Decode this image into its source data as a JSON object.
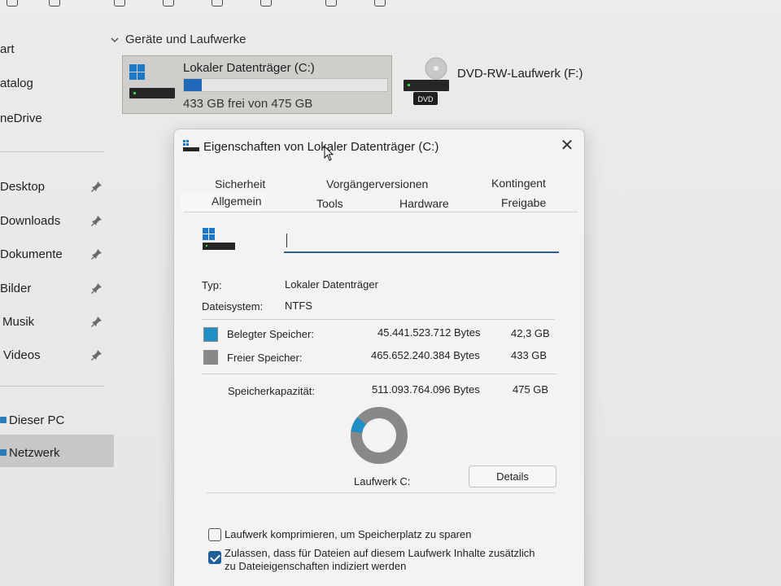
{
  "explorer": {
    "sidebar": {
      "items": [
        {
          "label": "art"
        },
        {
          "label": "atalog"
        },
        {
          "label": "neDrive"
        },
        {
          "label": "Desktop"
        },
        {
          "label": "Downloads"
        },
        {
          "label": "Dokumente"
        },
        {
          "label": "Bilder"
        },
        {
          "label": "Musik"
        },
        {
          "label": "Videos"
        },
        {
          "label": "Dieser PC"
        },
        {
          "label": "Netzwerk"
        }
      ]
    },
    "section_header": "Geräte und Laufwerke",
    "drive_c": {
      "name": "Lokaler Datenträger (C:)",
      "free_text": "433 GB frei von 475 GB",
      "used_fraction": 0.089
    },
    "drive_f": {
      "name": "DVD-RW-Laufwerk (F:)",
      "badge": "DVD"
    }
  },
  "dialog": {
    "title": "Eigenschaften von Lokaler Datenträger (C:)",
    "close_glyph": "✕",
    "tabs_row1": [
      "Sicherheit",
      "Vorgängerversionen",
      "Kontingent"
    ],
    "tabs_row2": [
      "Allgemein",
      "Tools",
      "Hardware",
      "Freigabe"
    ],
    "active_tab": "Allgemein",
    "name_value": "",
    "type_label": "Typ:",
    "type_value": "Lokaler Datenträger",
    "fs_label": "Dateisystem:",
    "fs_value": "NTFS",
    "used_label": "Belegter Speicher:",
    "used_bytes": "45.441.523.712 Bytes",
    "used_gb": "42,3 GB",
    "free_label": "Freier Speicher:",
    "free_bytes": "465.652.240.384 Bytes",
    "free_gb": "433 GB",
    "capacity_label": "Speicherkapazität:",
    "capacity_bytes": "511.093.764.096 Bytes",
    "capacity_gb": "475 GB",
    "drive_label": "Laufwerk C:",
    "details_button": "Details",
    "compress_label": "Laufwerk komprimieren, um Speicherplatz zu sparen",
    "compress_checked": false,
    "index_label_line1": "Zulassen, dass für Dateien auf diesem Laufwerk Inhalte zusätzlich",
    "index_label_line2": "zu Dateieigenschaften indiziert werden",
    "index_checked": true,
    "used_fraction": 0.089,
    "colors": {
      "used": "#1f8fc4",
      "free": "#888888",
      "accent": "#2c5d8f"
    }
  }
}
